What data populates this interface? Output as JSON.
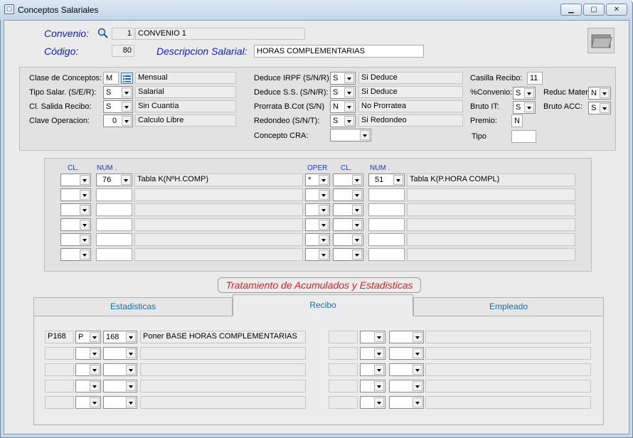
{
  "window": {
    "title": "Conceptos Salariales",
    "min": "▁",
    "max": "▢",
    "close": "✕"
  },
  "header": {
    "convenio_label": "Convenio:",
    "convenio_num": "1",
    "convenio_name": "CONVENIO 1",
    "codigo_label": "Código:",
    "codigo_value": "80",
    "descripcion_label": "Descripcion Salarial:",
    "descripcion_value": "HORAS COMPLEMENTARIAS"
  },
  "fields": {
    "clase_label": "Clase de Conceptos:",
    "clase_value": "M",
    "clase_desc": "Mensual",
    "tipo_label": "Tipo Salar. (S/E/R):",
    "tipo_value": "S",
    "tipo_desc": "Salarial",
    "salida_label": "Cl. Salida Recibo:",
    "salida_value": "S",
    "salida_desc": "Sin Cuantía",
    "clave_label": "Clave Operacion:",
    "clave_value": "0",
    "clave_desc": "Calculo Libre",
    "irpf_label": "Deduce IRPF (S/N/R):",
    "irpf_value": "S",
    "irpf_desc": "Si Deduce",
    "ss_label": "Deduce S.S. (S/N/R):",
    "ss_value": "S",
    "ss_desc": "Si Deduce",
    "prorrata_label": "Prorrata B.Cot (S/N)",
    "prorrata_value": "N",
    "prorrata_desc": "No Prorratea",
    "redondeo_label": "Redondeo (S/N/T):",
    "redondeo_value": "S",
    "redondeo_desc": "Si Redondeo",
    "cra_label": "Concepto CRA:",
    "cra_value": "",
    "casilla_label": "Casilla Recibo:",
    "casilla_value": "11",
    "pconvenio_label": "%Convenio:",
    "pconvenio_value": "S",
    "bruto_it_label": "Bruto IT:",
    "bruto_it_value": "S",
    "premio_label": "Premio:",
    "premio_value": "N",
    "tipo2_label": "Tipo",
    "tipo2_value": "",
    "reduc_label": "Reduc Mater",
    "reduc_value": "N",
    "bruto_acc_label": "Bruto ACC:",
    "bruto_acc_value": "S"
  },
  "formula": {
    "headers": {
      "cl1": "CL.",
      "num1": "NUM .",
      "oper": "OPER",
      "cl2": "CL.",
      "num2": "NUM ."
    },
    "rows": [
      {
        "cl1": "",
        "num1": "76",
        "desc1": "Tabla K(NºH.COMP)",
        "oper": "*",
        "cl2": "",
        "num2": "51",
        "desc2": "Tabla K(P.HORA COMPL)"
      },
      {
        "cl1": "",
        "num1": "",
        "desc1": "",
        "oper": "",
        "cl2": "",
        "num2": "",
        "desc2": ""
      },
      {
        "cl1": "",
        "num1": "",
        "desc1": "",
        "oper": "",
        "cl2": "",
        "num2": "",
        "desc2": ""
      },
      {
        "cl1": "",
        "num1": "",
        "desc1": "",
        "oper": "",
        "cl2": "",
        "num2": "",
        "desc2": ""
      },
      {
        "cl1": "",
        "num1": "",
        "desc1": "",
        "oper": "",
        "cl2": "",
        "num2": "",
        "desc2": ""
      },
      {
        "cl1": "",
        "num1": "",
        "desc1": "",
        "oper": "",
        "cl2": "",
        "num2": "",
        "desc2": ""
      }
    ]
  },
  "tratamiento_label": "Tratamiento de Acumulados y Estadisticas",
  "tabs": [
    {
      "label": "Estadisticas"
    },
    {
      "label": "Recibo"
    },
    {
      "label": "Empleado"
    }
  ],
  "recibo": {
    "rows": [
      {
        "code": "P168",
        "type": "P",
        "num": "168",
        "desc": "Poner  BASE HORAS COMPLEMENTARIAS"
      },
      {
        "code": "",
        "type": "",
        "num": "",
        "desc": ""
      },
      {
        "code": "",
        "type": "",
        "num": "",
        "desc": ""
      },
      {
        "code": "",
        "type": "",
        "num": "",
        "desc": ""
      },
      {
        "code": "",
        "type": "",
        "num": "",
        "desc": ""
      }
    ]
  }
}
